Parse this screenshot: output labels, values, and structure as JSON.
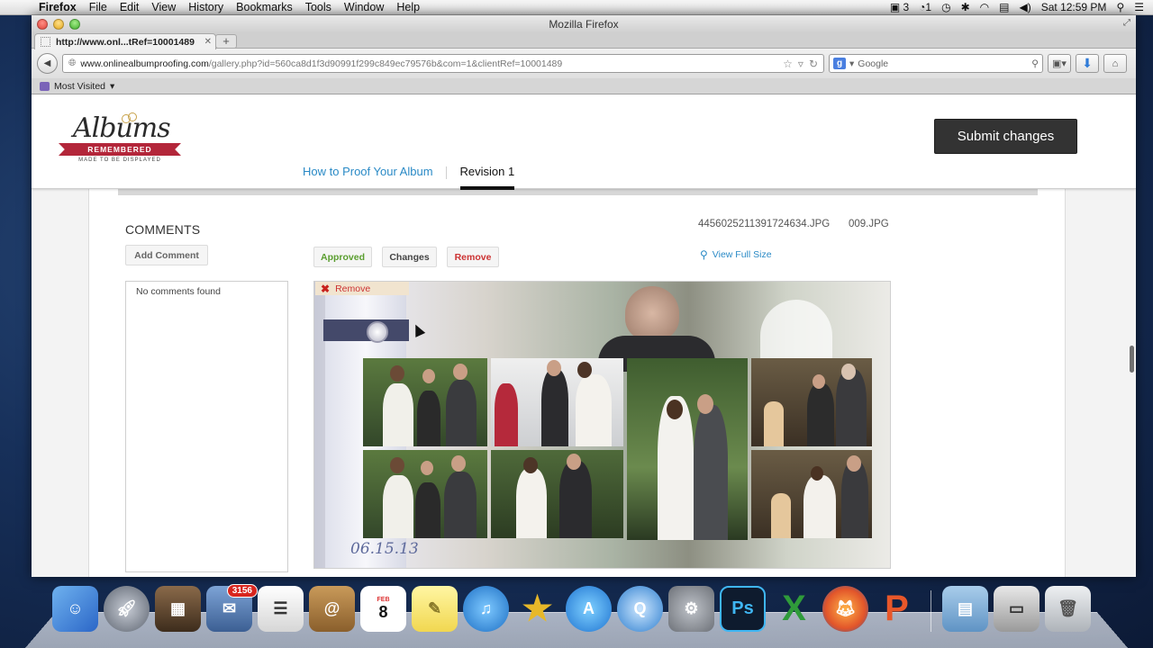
{
  "menubar": {
    "app": "Firefox",
    "items": [
      "File",
      "Edit",
      "View",
      "History",
      "Bookmarks",
      "Tools",
      "Window",
      "Help"
    ],
    "status": {
      "adobe_count": "3",
      "notif_count": "1",
      "clock": "Sat 12:59 PM"
    }
  },
  "window": {
    "title": "Mozilla Firefox"
  },
  "tab": {
    "label": "http://www.onl...tRef=10001489"
  },
  "navbar": {
    "url_domain": "www.onlinealbumproofing.com",
    "url_path": "/gallery.php?id=560ca8d1f3d90991f299c849ec79576b&com=1&clientRef=10001489",
    "search_placeholder": "Google"
  },
  "bookmarks": {
    "most_visited": "Most Visited"
  },
  "header": {
    "logo": {
      "script": "Albums",
      "ribbon": "REMEMBERED",
      "tagline": "MADE TO BE DISPLAYED"
    },
    "nav": {
      "how_to": "How to Proof Your Album",
      "revision": "Revision 1"
    },
    "submit_label": "Submit changes"
  },
  "comments": {
    "title": "COMMENTS",
    "add_label": "Add Comment",
    "empty_text": "No comments found"
  },
  "actions": {
    "approved": "Approved",
    "changes": "Changes",
    "remove": "Remove"
  },
  "files": {
    "left": "4456025211391724634.JPG",
    "right": "009.JPG"
  },
  "view_full_size": "View Full Size",
  "spread": {
    "remove_tag": "Remove",
    "date": "06.15.13"
  },
  "dock": {
    "mail_badge": "3156",
    "calendar_month": "FEB",
    "calendar_day": "8"
  },
  "colors": {
    "link": "#2a8ac6",
    "approved": "#5a9e2f",
    "remove": "#cc3333",
    "submit_bg": "#333333"
  }
}
